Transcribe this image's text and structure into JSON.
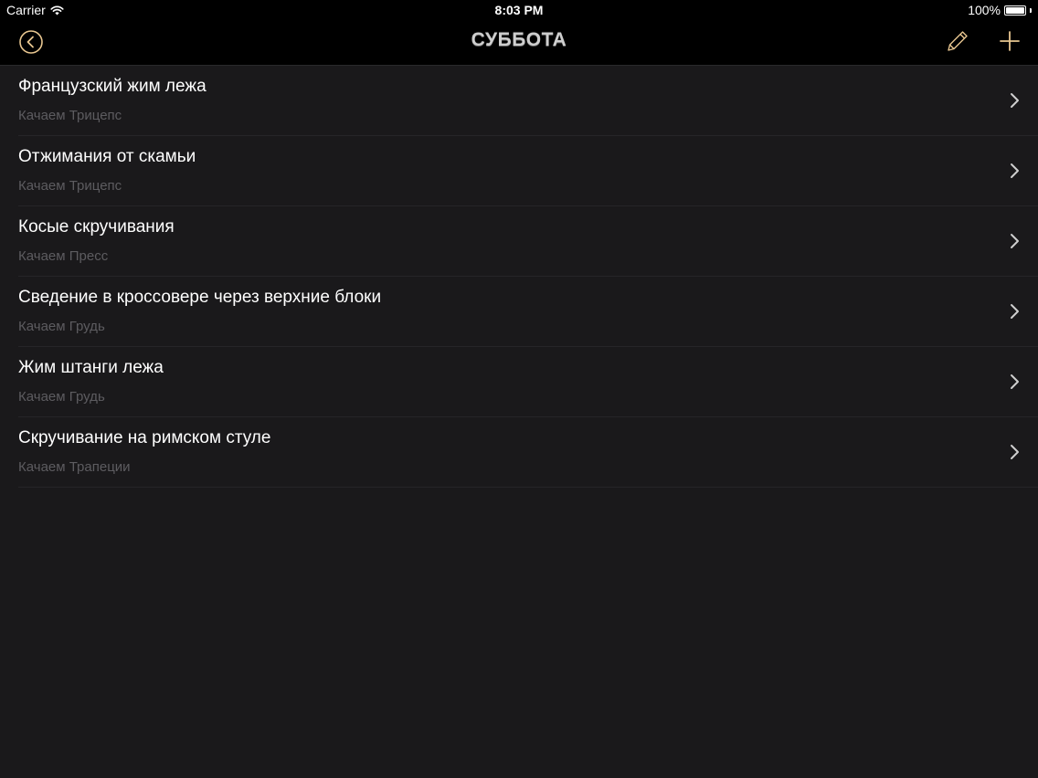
{
  "status_bar": {
    "carrier": "Carrier",
    "time": "8:03 PM",
    "battery": "100%",
    "battery_level": 1.0,
    "icons": [
      "wifi-icon",
      "battery-icon"
    ]
  },
  "nav": {
    "title": "СУББОТА",
    "back_icon": "back-circle-icon",
    "edit_icon": "pencil-icon",
    "add_icon": "plus-icon",
    "accent_color": "#e8c690"
  },
  "exercises": [
    {
      "title": "Французский жим лежа",
      "subtitle": "Качаем Трицепс"
    },
    {
      "title": "Отжимания от скамьи",
      "subtitle": "Качаем Трицепс"
    },
    {
      "title": "Косые скручивания",
      "subtitle": "Качаем Пресс"
    },
    {
      "title": "Сведение в кроссовере через верхние блоки",
      "subtitle": "Качаем Грудь"
    },
    {
      "title": "Жим штанги лежа",
      "subtitle": "Качаем Грудь"
    },
    {
      "title": "Скручивание на римском стуле",
      "subtitle": "Качаем Трапеции"
    }
  ],
  "colors": {
    "background": "#1a191b",
    "bar": "#000000",
    "title_text": "#ffffff",
    "subtitle_text": "#5d5c60",
    "chevron": "#cfcfcf"
  }
}
